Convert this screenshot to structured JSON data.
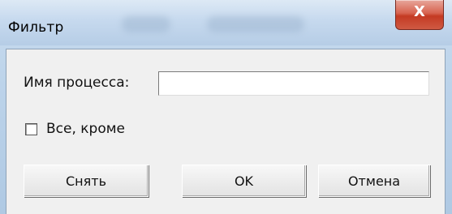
{
  "window": {
    "title": "Фильтр",
    "close_glyph": "X"
  },
  "form": {
    "process_name_label": "Имя процесса:",
    "process_name_value": "",
    "except_label": "Все, кроме",
    "except_checked": false
  },
  "buttons": {
    "clear_label": "Снять",
    "ok_label": "OK",
    "cancel_label": "Отмена"
  },
  "icons": {
    "close": "close-icon",
    "checkbox": "checkbox-icon"
  },
  "colors": {
    "titlebar": "#c6d9ee",
    "close_button": "#c43a23",
    "client_background": "#f0f0f0"
  }
}
